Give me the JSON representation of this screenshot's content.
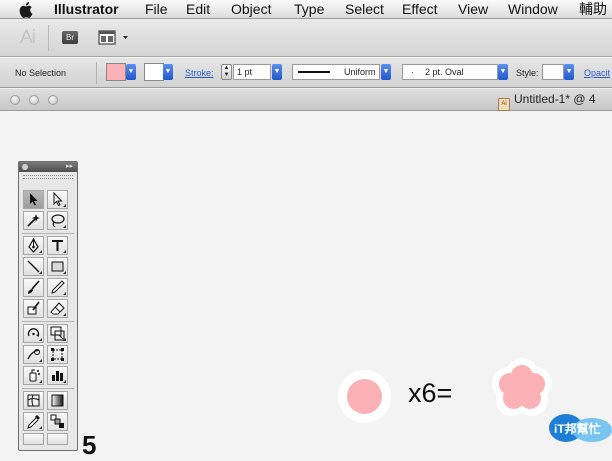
{
  "menubar": {
    "app": "Illustrator",
    "items": [
      "File",
      "Edit",
      "Object",
      "Type",
      "Select",
      "Effect",
      "View",
      "Window",
      "輔助"
    ]
  },
  "appbar": {
    "logo": "Ai",
    "bridge": "Br"
  },
  "control": {
    "selection": "No Selection",
    "fill_color": "#fbb1b6",
    "stroke_label": "Stroke:",
    "stroke_weight": "1 pt",
    "stroke_style": "Uniform",
    "brush": "2 pt. Oval",
    "brush_dot": "·",
    "style_label": "Style:",
    "opacity_label": "Opacit"
  },
  "document": {
    "tab_title": "Untitled-1* @ 4",
    "icon": "Ai"
  },
  "toolbox": {
    "tools": [
      "selection-tool",
      "direct-selection-tool",
      "magic-wand-tool",
      "lasso-tool",
      "pen-tool",
      "type-tool",
      "line-tool",
      "rectangle-tool",
      "paintbrush-tool",
      "pencil-tool",
      "blob-brush-tool",
      "eraser-tool",
      "rotate-tool",
      "scale-tool",
      "warp-tool",
      "free-transform-tool",
      "symbol-sprayer-tool",
      "column-graph-tool",
      "mesh-tool",
      "gradient-tool",
      "eyedropper-tool",
      "blend-tool"
    ]
  },
  "artwork": {
    "equation": "x6=",
    "circle_color": "#fbb1b6",
    "number": "5",
    "badge_text": "iT邦幫忙"
  }
}
